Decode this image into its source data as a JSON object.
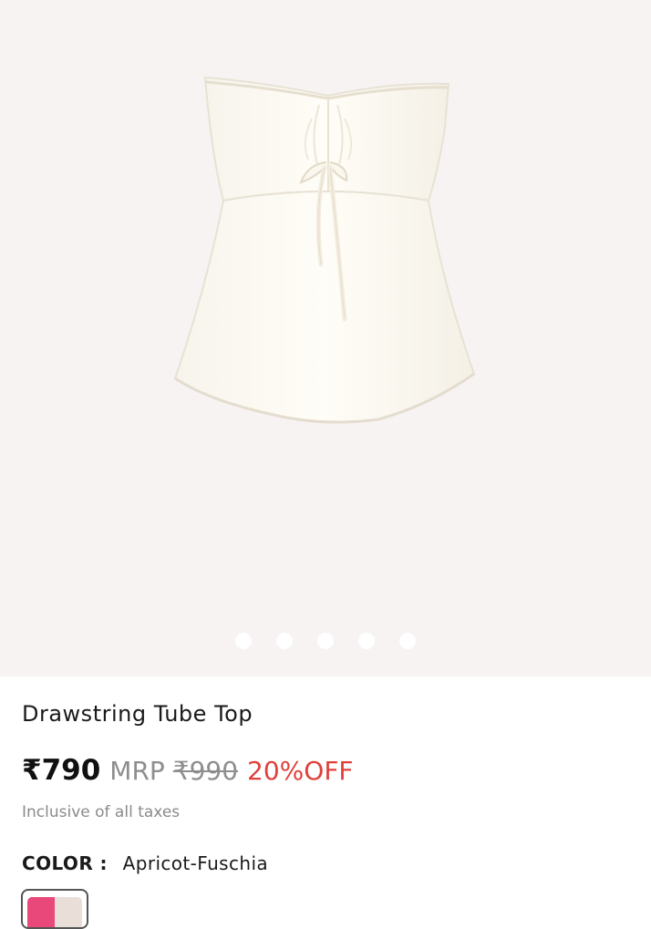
{
  "product": {
    "title": "Drawstring Tube Top",
    "price": "₹790",
    "mrp_label": "MRP",
    "mrp_value": "₹990",
    "discount": "20%OFF",
    "tax_note": "Inclusive of all taxes",
    "color_label": "COLOR :",
    "color_value": "Apricot-Fuschia"
  },
  "gallery": {
    "dot_count": 5
  },
  "colors": {
    "background": "#f7f3f3",
    "discount": "#e0403c",
    "swatch_primary": "#e9487a",
    "swatch_secondary": "#eadfd8"
  }
}
